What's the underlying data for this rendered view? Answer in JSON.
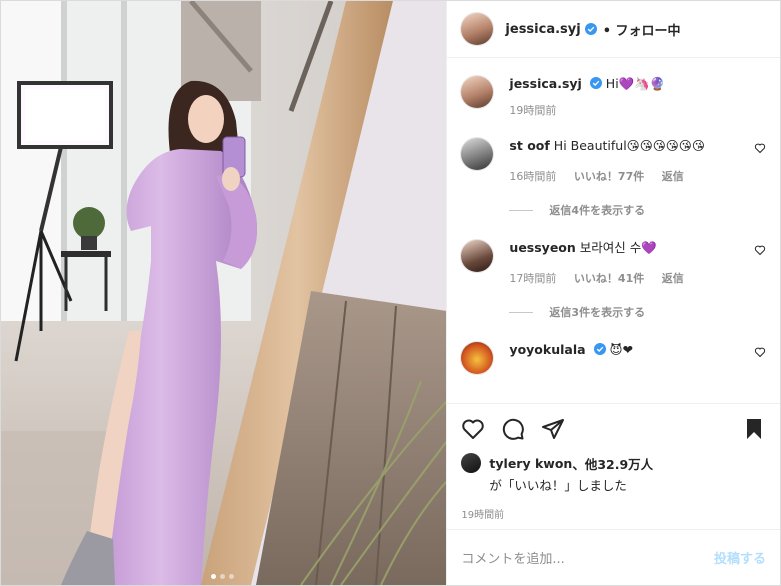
{
  "header": {
    "username": "jessica.syj",
    "follow_status": "• フォロー中"
  },
  "caption": {
    "username": "jessica.syj",
    "text": "Hi💜🦄🔮",
    "time": "19時間前"
  },
  "comments": [
    {
      "username": "st   oof",
      "text": "Hi Beautiful😘😘😘😘😘😘",
      "time": "16時間前",
      "likes": "いいね！77件",
      "reply": "返信",
      "view_replies": "返信4件を表示する"
    },
    {
      "username": "  uessyeon",
      "text": "보라여신 수💜",
      "time": "17時間前",
      "likes": "いいね！41件",
      "reply": "返信",
      "view_replies": "返信3件を表示する"
    },
    {
      "username": "yoyokulala",
      "text": "😈❤"
    }
  ],
  "likes_summary": {
    "line1_user": "tylery  kwon",
    "line1_rest": "、他32.9万人",
    "line2": "が「いいね！」しました"
  },
  "post_time": "19時間前",
  "add_comment": {
    "placeholder": "コメントを追加...",
    "post_button": "投稿する"
  },
  "colors": {
    "dress": "#c9a0d8",
    "verified": "#3897f0",
    "post_button": "#b2dffc"
  }
}
